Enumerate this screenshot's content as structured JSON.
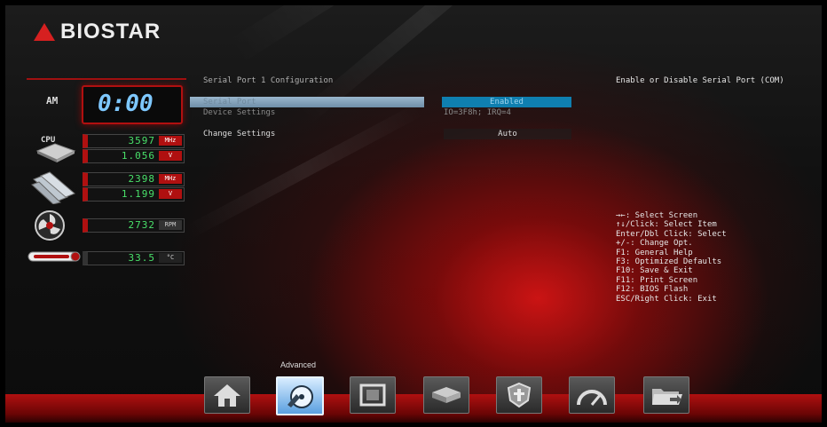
{
  "brand": {
    "name": "BIOSTAR"
  },
  "clock": {
    "period": "AM",
    "time": "0:00"
  },
  "hardware": {
    "cpu_label": "CPU",
    "cpu_freq": "3597",
    "cpu_freq_unit": "MHz",
    "cpu_voltage": "1.056",
    "cpu_voltage_unit": "V",
    "mem_freq": "2398",
    "mem_freq_unit": "MHz",
    "mem_voltage": "1.199",
    "mem_voltage_unit": "V",
    "fan_speed": "2732",
    "fan_unit": "RPM",
    "temperature": "33.5",
    "temperature_unit": "°C"
  },
  "page": {
    "title": "Serial Port 1 Configuration",
    "rows": [
      {
        "label": "Serial Port",
        "value": "Enabled"
      },
      {
        "label": "Device Settings",
        "value": "IO=3F8h; IRQ=4"
      },
      {
        "label": "Change Settings",
        "value": "Auto"
      }
    ]
  },
  "help": {
    "description": "Enable or Disable Serial Port (COM)",
    "keys": [
      "→←: Select Screen",
      "↑↓/Click: Select Item",
      "Enter/Dbl Click: Select",
      "+/-: Change Opt.",
      "F1: General Help",
      "F3: Optimized Defaults",
      "F10: Save & Exit",
      "F11: Print Screen",
      "F12: BIOS Flash",
      "ESC/Right Click: Exit"
    ]
  },
  "nav": {
    "active_label": "Advanced",
    "tabs": [
      {
        "icon": "home-icon"
      },
      {
        "icon": "advanced-disc-icon",
        "active": true
      },
      {
        "icon": "chipset-icon"
      },
      {
        "icon": "boot-drive-icon"
      },
      {
        "icon": "security-shield-icon"
      },
      {
        "icon": "performance-gauge-icon"
      },
      {
        "icon": "save-exit-folder-icon"
      }
    ]
  },
  "colors": {
    "accent_red": "#b01010",
    "selection_blue": "#0f7fb0",
    "digit_green": "#49e06a",
    "clock_blue": "#7ec8ff"
  }
}
